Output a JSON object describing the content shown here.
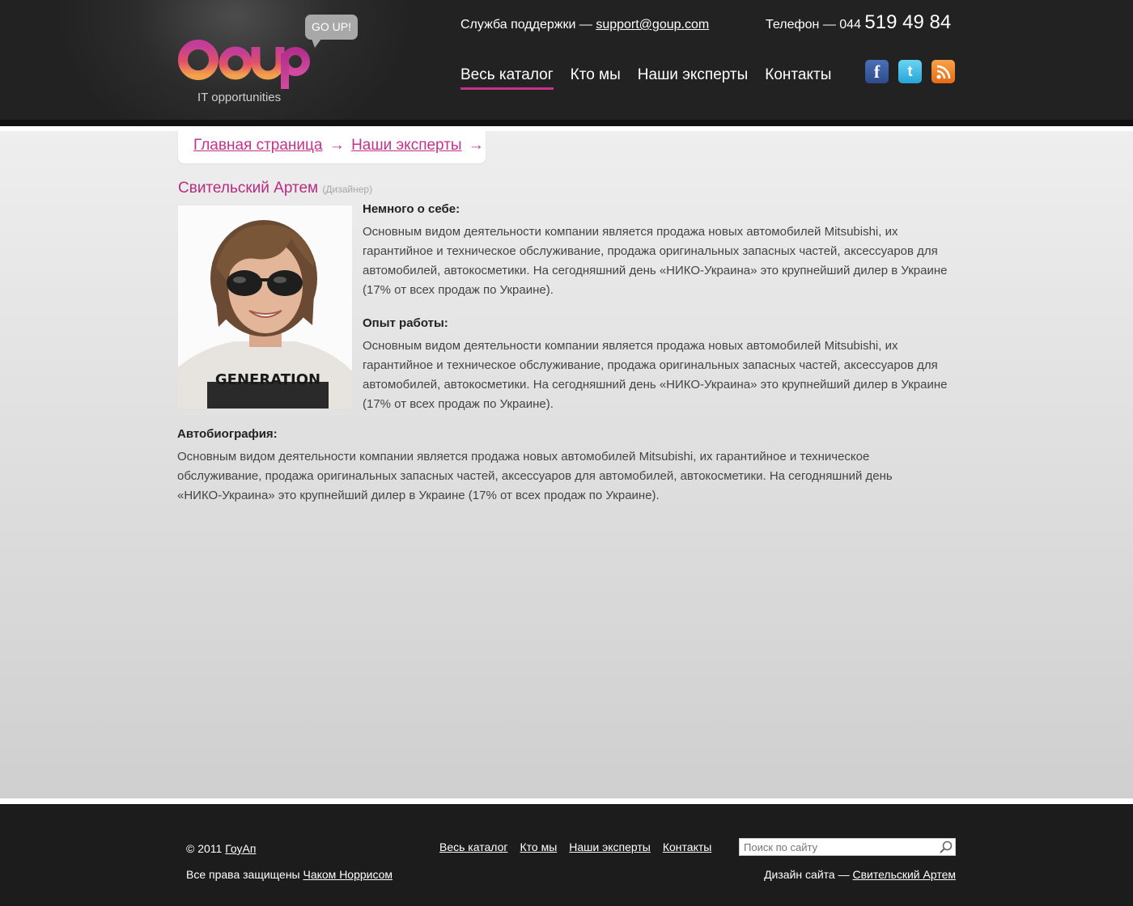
{
  "header": {
    "logo_bubble": "GO UP!",
    "logo_tagline": "IT opportunities",
    "support_label": "Служба поддержки — ",
    "support_email": "support@goup.com",
    "phone_label": "Телефон — 044 ",
    "phone_number": "519 49 84",
    "nav": [
      "Весь каталог",
      "Кто мы",
      "Наши эксперты",
      "Контакты"
    ],
    "social": [
      "facebook-icon",
      "twitter-icon",
      "rss-icon"
    ]
  },
  "breadcrumb": {
    "home": "Главная страница",
    "experts": "Наши эксперты",
    "arrow": "→"
  },
  "profile": {
    "name": "Свительский Артем",
    "role": "(Дизайнер)",
    "about_title": "Немного о себе:",
    "about_text": " Основным видом деятельности компании является продажа новых автомобилей Mitsubishi, их гарантийное и техническое обслуживание, продажа оригинальных запасных частей, аксессуаров для автомобилей, автокосметики. На сегодняшний день «НИКО-Украина» это крупнейший дилер в Украине (17% от всех продаж по Украине).",
    "experience_title": "Опыт работы:",
    "experience_text": " Основным видом деятельности компании является продажа новых автомобилей Mitsubishi, их гарантийное и техническое обслуживание, продажа оригинальных запасных частей, аксессуаров для автомобилей, автокосметики. На сегодняшний день «НИКО-Украина» это крупнейший дилер в Украине (17% от всех продаж по Украине).",
    "bio_title": "Автобиография:",
    "bio_text": " Основным видом деятельности компании является продажа новых автомобилей Mitsubishi, их гарантийное и техническое обслуживание, продажа оригинальных запасных частей, аксессуаров для автомобилей, автокосметики. На сегодняшний день «НИКО-Украина» это крупнейший дилер в Украине (17% от всех продаж по Украине).",
    "shirt_text": "GENERATION"
  },
  "footer": {
    "copy_prefix": "© 2011 ",
    "copy_link": "ГоуАп",
    "rights_prefix": "Все права защищены ",
    "rights_link": "Чаком Норрисом",
    "nav": [
      "Весь каталог",
      "Кто мы",
      "Наши эксперты",
      "Контакты"
    ],
    "search_placeholder": "Поиск по сайту",
    "design_prefix": "Дизайн сайта — ",
    "design_link": "Свительский Артем"
  },
  "colors": {
    "accent": "#c4328a",
    "logo_orange": "#f08a3c",
    "logo_purple": "#b22f8c"
  }
}
